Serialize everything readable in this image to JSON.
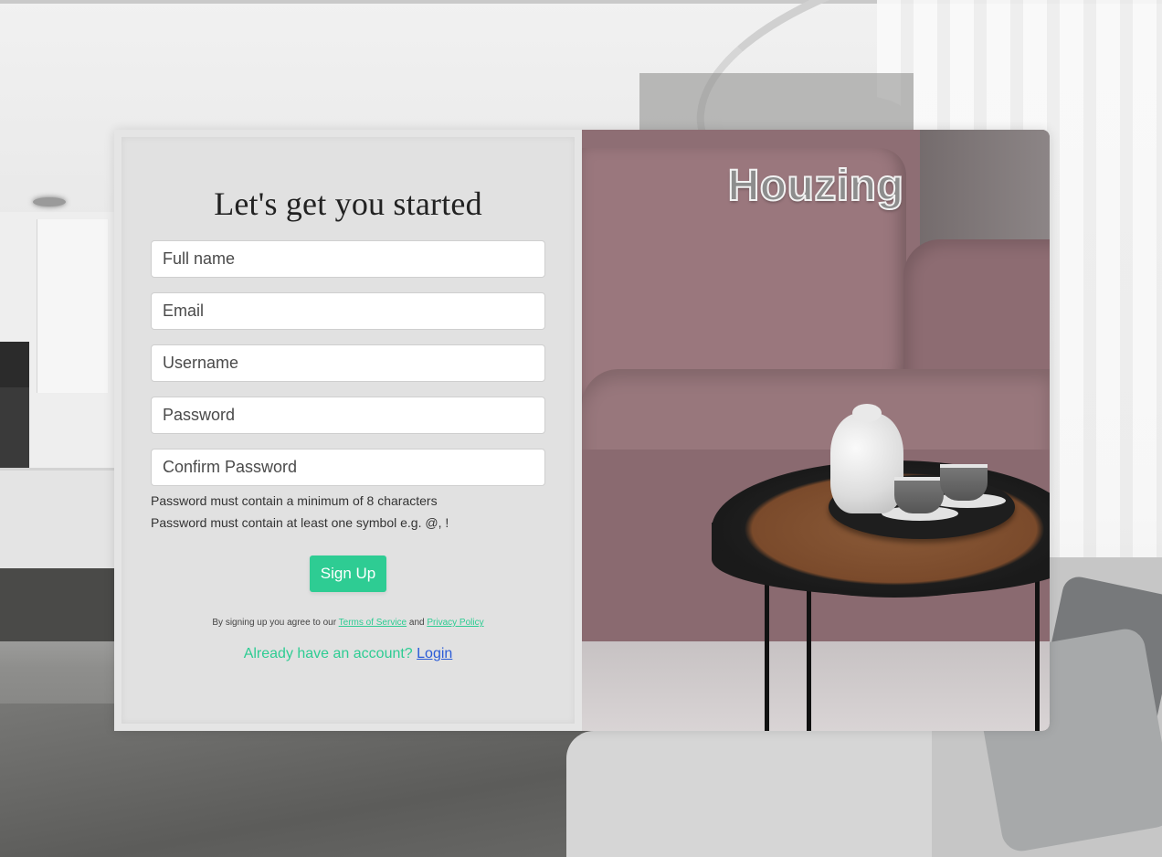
{
  "form": {
    "title": "Let's get you started",
    "fields": [
      {
        "placeholder": "Full name",
        "value": ""
      },
      {
        "placeholder": "Email",
        "value": ""
      },
      {
        "placeholder": "Username",
        "value": ""
      },
      {
        "placeholder": "Password",
        "value": ""
      },
      {
        "placeholder": "Confirm Password",
        "value": ""
      }
    ],
    "hints": [
      "Password must contain a minimum of 8 characters",
      "Password must contain at least one symbol e.g. @, !"
    ],
    "submit_label": "Sign Up",
    "terms": {
      "prefix": "By signing up you agree to our",
      "tos_label": "Terms of Service",
      "conjunction": "and",
      "privacy_label": "Privacy Policy"
    },
    "login": {
      "prompt": "Already have an account?",
      "link_label": "Login"
    }
  },
  "brand": {
    "name": "Houzing"
  },
  "colors": {
    "accent": "#2ecc93",
    "link": "#2a5bd7",
    "panel": "#e1e1e1"
  }
}
